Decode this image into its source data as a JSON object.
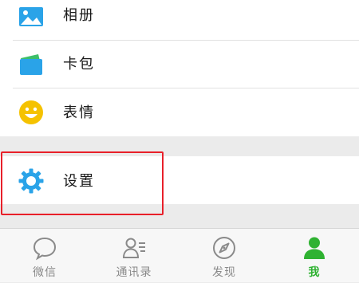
{
  "menu": {
    "group1": [
      {
        "label": "相册",
        "icon": "photo-album-icon"
      },
      {
        "label": "卡包",
        "icon": "card-wallet-icon"
      },
      {
        "label": "表情",
        "icon": "smiley-face-icon"
      }
    ],
    "group2": [
      {
        "label": "设置",
        "icon": "settings-gear-icon"
      }
    ]
  },
  "tabbar": {
    "tabs": [
      {
        "label": "微信",
        "icon": "chat-bubble-icon",
        "active": false
      },
      {
        "label": "通讯录",
        "icon": "contacts-icon",
        "active": false
      },
      {
        "label": "发现",
        "icon": "compass-icon",
        "active": false
      },
      {
        "label": "我",
        "icon": "person-icon",
        "active": true
      }
    ]
  },
  "colors": {
    "accent_green": "#2fb232",
    "icon_blue": "#2aa3e8",
    "smiley_yellow": "#f5c200",
    "highlight_red": "#e8202a",
    "background_gray": "#ebebeb"
  }
}
